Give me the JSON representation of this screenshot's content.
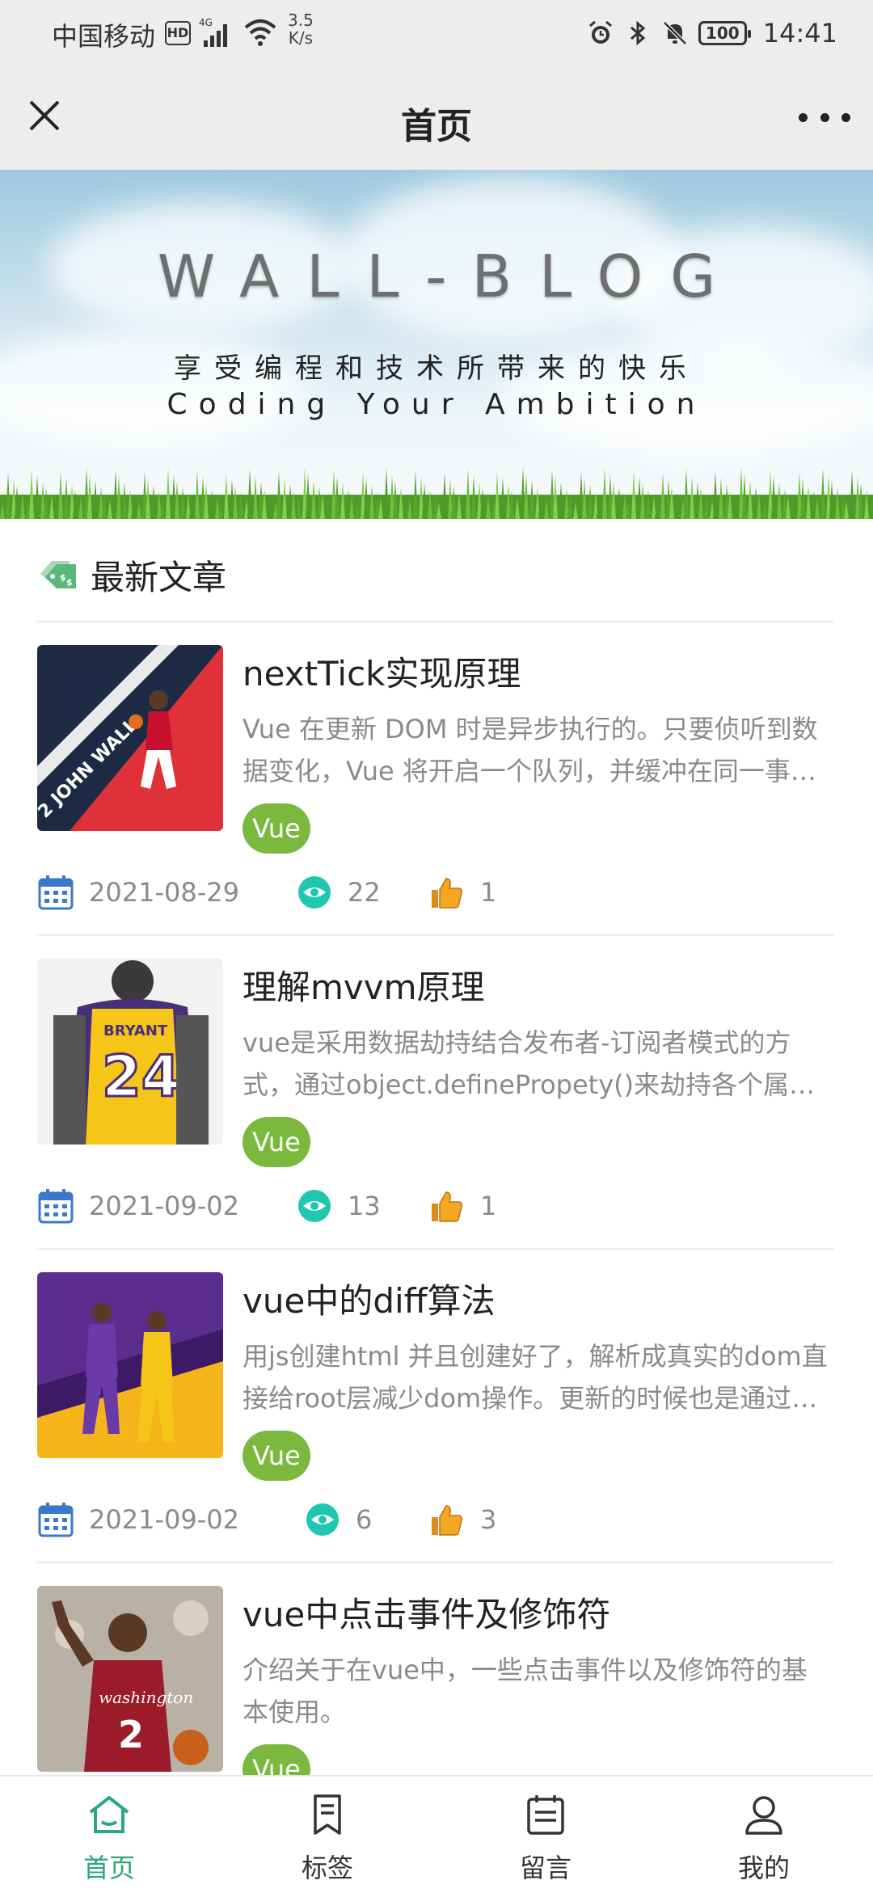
{
  "status_bar": {
    "carrier": "中国移动",
    "hd": "HD",
    "network": "4G",
    "speed_value": "3.5",
    "speed_unit": "K/s",
    "battery": "100",
    "time": "14:41"
  },
  "titlebar": {
    "title": "首页"
  },
  "hero": {
    "title": "WALL-BLOG",
    "subtitle_cn": "享受编程和技术所带来的快乐",
    "subtitle_en": "Coding Your Ambition"
  },
  "section": {
    "title": "最新文章"
  },
  "articles": [
    {
      "title": "nextTick实现原理",
      "desc": "Vue 在更新 DOM 时是异步执行的。只要侦听到数据变化，Vue 将开启一个队列，并缓冲在同一事件循环中发生的所有数据变更。",
      "tag": "Vue",
      "date": "2021-08-29",
      "views": "22",
      "likes": "1",
      "thumb": "basketball-player-red"
    },
    {
      "title": "理解mvvm原理",
      "desc": "vue是采用数据劫持结合发布者-订阅者模式的方式，通过object.definePropety()来劫持各个属性的setter和getter。",
      "tag": "Vue",
      "date": "2021-09-02",
      "views": "13",
      "likes": "1",
      "thumb": "jersey-24"
    },
    {
      "title": "vue中的diff算法",
      "desc": "用js创建html 并且创建好了，解析成真实的dom直接给root层减少dom操作。更新的时候也是通过diff算法。",
      "tag": "Vue",
      "date": "2021-09-02",
      "views": "6",
      "likes": "3",
      "thumb": "two-players-purple"
    },
    {
      "title": "vue中点击事件及修饰符",
      "desc": "介绍关于在vue中，一些点击事件以及修饰符的基本使用。",
      "tag": "Vue",
      "date": "",
      "views": "",
      "likes": "",
      "thumb": "player-washington"
    }
  ],
  "tabbar": [
    {
      "label": "首页",
      "icon": "home-icon",
      "active": true
    },
    {
      "label": "标签",
      "icon": "bookmark-icon",
      "active": false
    },
    {
      "label": "留言",
      "icon": "message-board-icon",
      "active": false
    },
    {
      "label": "我的",
      "icon": "user-icon",
      "active": false
    }
  ],
  "colors": {
    "accent": "#2aa876",
    "tag_green": "#7ab83e",
    "views_teal": "#1fc7b0",
    "like_orange": "#f5a623",
    "calendar_blue": "#3a78c9"
  }
}
